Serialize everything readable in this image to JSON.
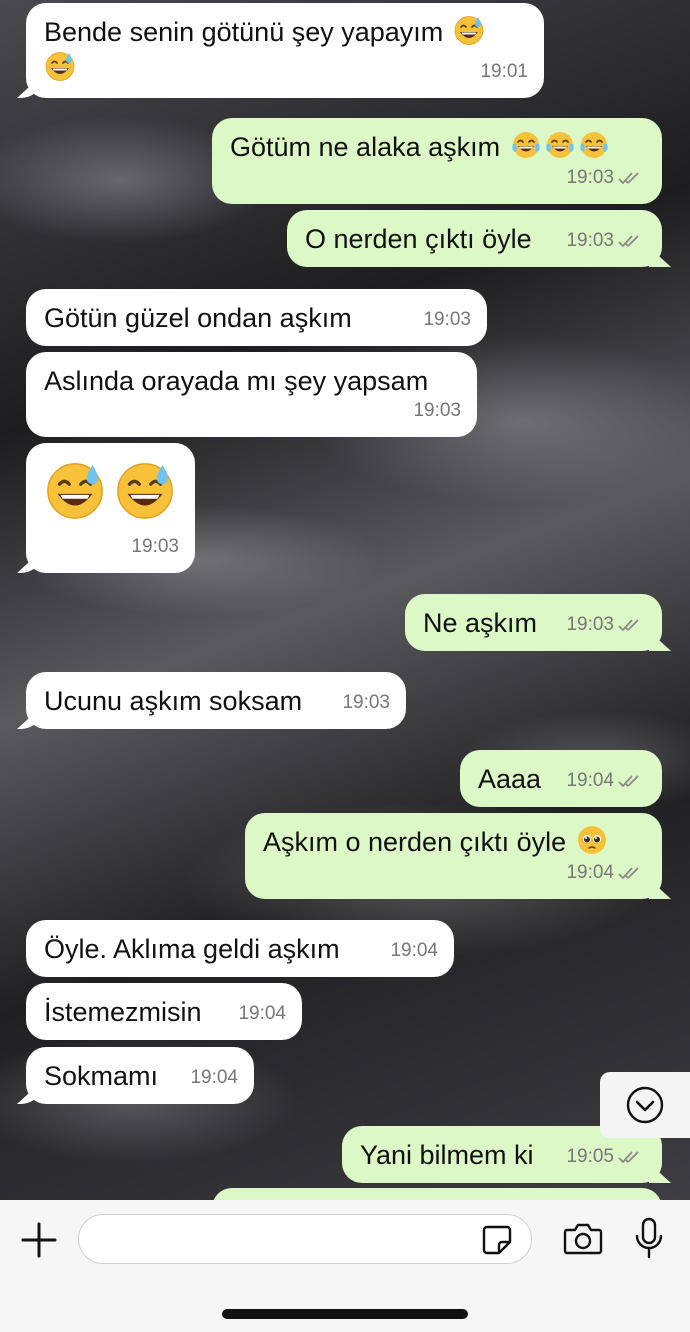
{
  "chat": {
    "messages": [
      {
        "id": "m1",
        "dir": "in",
        "text": "Bende senin götünü şey yapayım",
        "time": "19:01",
        "emoji": "grinning-sweat-face-icon",
        "emoji_count": 2
      },
      {
        "id": "m2",
        "dir": "out",
        "text": "Götüm ne alaka aşkım",
        "time": "19:03",
        "status": "read-ticks",
        "emoji": "tears-of-joy-face-icon",
        "emoji_count": 3
      },
      {
        "id": "m3",
        "dir": "out",
        "text": "O nerden çıktı öyle",
        "time": "19:03",
        "status": "read-ticks"
      },
      {
        "id": "m4",
        "dir": "in",
        "text": "Götün güzel ondan aşkım",
        "time": "19:03"
      },
      {
        "id": "m5",
        "dir": "in",
        "text": "Aslında orayada mı şey yapsam",
        "time": "19:03"
      },
      {
        "id": "m6",
        "dir": "in",
        "text": "",
        "time": "19:03",
        "emoji": "grinning-sweat-face-icon",
        "emoji_count": 2,
        "emoji_only": true
      },
      {
        "id": "m7",
        "dir": "out",
        "text": "Ne aşkım",
        "time": "19:03",
        "status": "read-ticks"
      },
      {
        "id": "m8",
        "dir": "in",
        "text": "Ucunu aşkım soksam",
        "time": "19:03"
      },
      {
        "id": "m9",
        "dir": "out",
        "text": "Aaaa",
        "time": "19:04",
        "status": "read-ticks"
      },
      {
        "id": "m10",
        "dir": "out",
        "text": "Aşkım o nerden çıktı öyle",
        "time": "19:04",
        "status": "read-ticks",
        "emoji": "pleading-face-icon",
        "emoji_count": 1
      },
      {
        "id": "m11",
        "dir": "in",
        "text": "Öyle. Aklıma geldi aşkım",
        "time": "19:04"
      },
      {
        "id": "m12",
        "dir": "in",
        "text": "İstemezmisin",
        "time": "19:04"
      },
      {
        "id": "m13",
        "dir": "in",
        "text": "Sokmamı",
        "time": "19:04"
      },
      {
        "id": "m14",
        "dir": "out",
        "text": "Yani bilmem ki",
        "time": "19:05",
        "status": "read-ticks"
      }
    ],
    "scroll_down_icon": "chevron-down-circle-icon"
  },
  "composer": {
    "input_value": "",
    "icons": [
      "plus-icon",
      "sticker-icon",
      "camera-icon",
      "microphone-icon"
    ]
  },
  "colors": {
    "incoming_bubble": "#ffffff",
    "outgoing_bubble": "#dcf8c6",
    "timestamp": "#777777",
    "toolbar_bg": "#f6f6f6"
  }
}
